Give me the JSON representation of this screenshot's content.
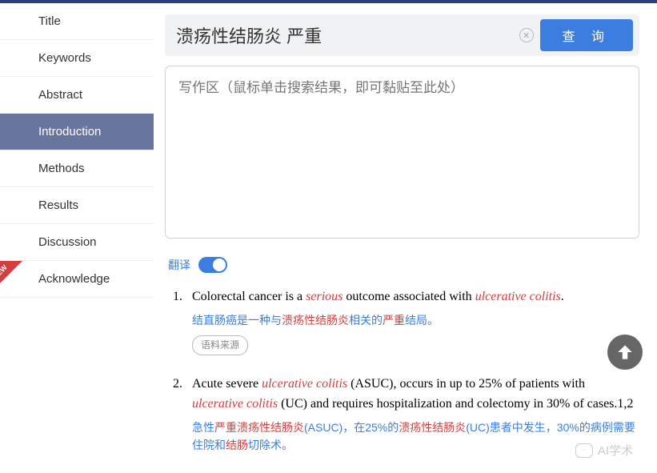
{
  "sidebar": {
    "items": [
      {
        "label": "Title",
        "active": false
      },
      {
        "label": "Keywords",
        "active": false
      },
      {
        "label": "Abstract",
        "active": false
      },
      {
        "label": "Introduction",
        "active": true
      },
      {
        "label": "Methods",
        "active": false
      },
      {
        "label": "Results",
        "active": false
      },
      {
        "label": "Discussion",
        "active": false
      },
      {
        "label": "Acknowledge",
        "active": false
      }
    ],
    "new_badge": "NEW"
  },
  "search": {
    "value": "溃疡性结肠炎 严重",
    "clear_glyph": "✕",
    "query_button": "查 询"
  },
  "write_area": {
    "placeholder": "写作区（鼠标单击搜索结果，即可黏贴至此处）"
  },
  "translate": {
    "label": "翻译",
    "on": true
  },
  "results": [
    {
      "num": "1.",
      "en_parts": [
        {
          "t": "Colorectal cancer is a ",
          "hl": false
        },
        {
          "t": "serious",
          "hl": true
        },
        {
          "t": " outcome associated with ",
          "hl": false
        },
        {
          "t": "ulcerative colitis",
          "hl": true
        },
        {
          "t": ".",
          "hl": false
        }
      ],
      "zh_parts": [
        {
          "t": "结直肠癌是一种与",
          "hl": false
        },
        {
          "t": "溃疡性结肠炎",
          "hl": true
        },
        {
          "t": "相关的",
          "hl": false
        },
        {
          "t": "严重",
          "hl": true
        },
        {
          "t": "结局。",
          "hl": false
        }
      ],
      "source_label": "语料来源"
    },
    {
      "num": "2.",
      "en_parts": [
        {
          "t": "Acute severe ",
          "hl": false
        },
        {
          "t": "ulcerative colitis",
          "hl": true
        },
        {
          "t": " (ASUC), occurs in up to 25% of patients with ",
          "hl": false
        },
        {
          "t": "ulcerative colitis",
          "hl": true
        },
        {
          "t": " (UC) and requires hospitalization and colectomy in 30% of cases.1,2",
          "hl": false
        }
      ],
      "zh_parts": [
        {
          "t": "急性",
          "hl": false
        },
        {
          "t": "严重溃疡性结肠炎",
          "hl": true
        },
        {
          "t": "(ASUC)，在25%的",
          "hl": false
        },
        {
          "t": "溃疡性结肠炎",
          "hl": true
        },
        {
          "t": "(UC)患者中发生，30%的病例需要住院和",
          "hl": false
        },
        {
          "t": "结肠",
          "hl": true
        },
        {
          "t": "切除术。",
          "hl": false
        }
      ],
      "source_label": "语料来源"
    }
  ],
  "watermark": "AI学术"
}
